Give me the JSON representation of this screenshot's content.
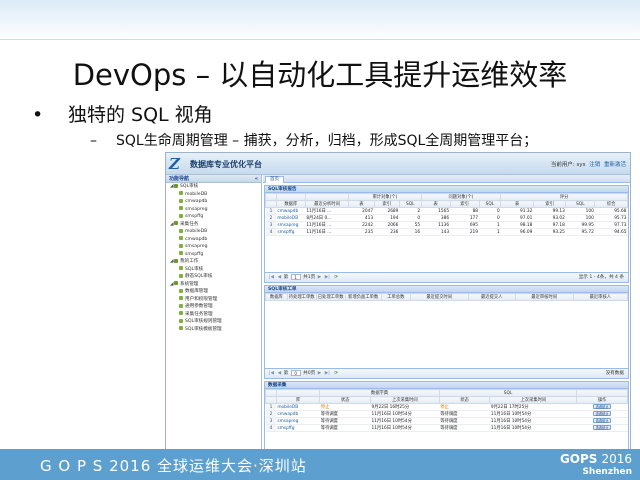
{
  "slide": {
    "title": "DevOps – 以自动化工具提升运维效率",
    "bullet1_marker": "•",
    "bullet1": "独特的 SQL 视角",
    "bullet2_marker": "–",
    "bullet2": "SQL生命周期管理 – 捕获，分析，归档，形成SQL全周期管理平台；"
  },
  "app": {
    "logo": "Z",
    "title": "数据库专业优化平台",
    "user_label": "当前用户: sys",
    "logout": "注销",
    "reactivate": "重新激活"
  },
  "sidebar": {
    "title": "功能导航",
    "collapse": "«",
    "items": [
      {
        "label": "SQL审核",
        "level": 0,
        "type": "folder"
      },
      {
        "label": "mobileDB",
        "level": 1,
        "type": "leaf"
      },
      {
        "label": "cmwapdb",
        "level": 1,
        "type": "leaf"
      },
      {
        "label": "smsapreg",
        "level": 1,
        "type": "leaf"
      },
      {
        "label": "smspffg",
        "level": 1,
        "type": "leaf"
      },
      {
        "label": "采集任务",
        "level": 0,
        "type": "folder"
      },
      {
        "label": "mobileDB",
        "level": 1,
        "type": "leaf"
      },
      {
        "label": "cmwapdb",
        "level": 1,
        "type": "leaf"
      },
      {
        "label": "smsapreg",
        "level": 1,
        "type": "leaf"
      },
      {
        "label": "smspffg",
        "level": 1,
        "type": "leaf"
      },
      {
        "label": "我的工作",
        "level": 0,
        "type": "folder"
      },
      {
        "label": "SQL审核",
        "level": 1,
        "type": "leaf"
      },
      {
        "label": "静态SQL审核",
        "level": 1,
        "type": "leaf"
      },
      {
        "label": "系统管理",
        "level": 0,
        "type": "folder"
      },
      {
        "label": "数据库管理",
        "level": 1,
        "type": "leaf"
      },
      {
        "label": "用户和权限管理",
        "level": 1,
        "type": "leaf"
      },
      {
        "label": "通用参数管理",
        "level": 1,
        "type": "leaf"
      },
      {
        "label": "采集任务管理",
        "level": 1,
        "type": "leaf"
      },
      {
        "label": "SQL审核规则管理",
        "level": 1,
        "type": "leaf"
      },
      {
        "label": "SQL审核模板管理",
        "level": 1,
        "type": "leaf"
      }
    ]
  },
  "main": {
    "tab": "首页",
    "review_report": {
      "title": "SQL审核报告",
      "group_headers": [
        "审计对象(个)",
        "问题对象(个)",
        "评分"
      ],
      "columns": [
        "",
        "数据库",
        "最近分析时间",
        "表",
        "索引",
        "SQL",
        "表",
        "索引",
        "SQL",
        "表",
        "索引",
        "SQL",
        "综合"
      ],
      "rows": [
        [
          "1",
          "cmwapdb",
          "11月16日 ...",
          "2047",
          "2689",
          "2",
          "1565",
          "88",
          "0",
          "91.32",
          "99.13",
          "100",
          "95.68"
        ],
        [
          "2",
          "mobileDB",
          "8月24日 0...",
          "413",
          "194",
          "0",
          "386",
          "177",
          "0",
          "97.01",
          "93.02",
          "100",
          "95.73"
        ],
        [
          "3",
          "smsapreg",
          "11月16日 ...",
          "2242",
          "2066",
          "55",
          "1136",
          "695",
          "1",
          "98.18",
          "97.18",
          "99.95",
          "97.73"
        ],
        [
          "4",
          "smspffg",
          "11月16日 ...",
          "235",
          "236",
          "16",
          "143",
          "219",
          "1",
          "96.09",
          "93.25",
          "95.72",
          "94.65"
        ]
      ],
      "pager": {
        "page_label": "第",
        "page": "1",
        "of_pages": "共1页",
        "info": "显示 1 - 4条，共 4 条"
      }
    },
    "workorders": {
      "title": "SQL审核工单",
      "columns": [
        "数据库",
        "待处理工单数",
        "已处理工单数",
        "新增负面工单数",
        "工单总数",
        "最近提交时间",
        "最近提交人",
        "最近审核时间",
        "最近审核人"
      ],
      "pager": {
        "page_label": "第",
        "page": "0",
        "of_pages": "共0页",
        "info": "没有数据"
      }
    },
    "collection": {
      "title": "数据采集",
      "group_headers": [
        "数据字典",
        "SQL"
      ],
      "columns": [
        "",
        "库",
        "状态",
        "上次采集时间",
        "状态",
        "上次采集时间",
        "操作"
      ],
      "rows": [
        [
          "1",
          "mobileDB",
          "停止",
          "9月22日 16时25分",
          "停止",
          "9月22日 17时25分",
          "查看统计"
        ],
        [
          "2",
          "cmwapdb",
          "等待调度",
          "11月16日 10时54分",
          "等待调度",
          "11月16日 10时54分",
          "查看统计"
        ],
        [
          "3",
          "smsapreg",
          "等待调度",
          "11月16日 10时54分",
          "等待调度",
          "11月16日 10时54分",
          "查看统计"
        ],
        [
          "4",
          "smspffg",
          "等待调度",
          "11月16日 10时54分",
          "等待调度",
          "11月16日 10时54分",
          "查看统计"
        ]
      ]
    }
  },
  "footer": {
    "event": "G O P S 2016 全球运维大会·深圳站",
    "brand_main": "GOPS",
    "brand_year": "2016",
    "brand_city": "Shenzhen"
  },
  "colors": {
    "footer_bg": "#5d9fcf",
    "panel_border": "#99bbe8",
    "link": "#1b5fa6",
    "warn": "#e07b00"
  }
}
